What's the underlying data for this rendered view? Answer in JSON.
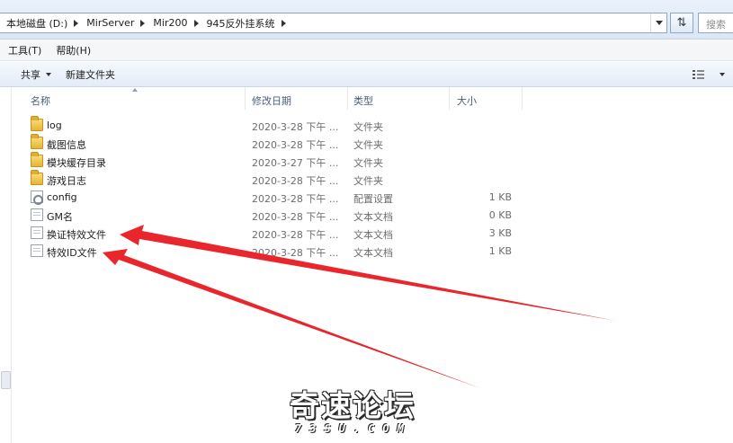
{
  "address_bar": {
    "crumbs": [
      "本地磁盘 (D:)",
      "MirServer",
      "Mir200",
      "945反外挂系统"
    ],
    "search_placeholder": "搜索"
  },
  "menu": {
    "items": [
      "工具(T)",
      "帮助(H)"
    ]
  },
  "toolbar": {
    "share_label": "共享",
    "new_folder_label": "新建文件夹"
  },
  "columns": {
    "name": "名称",
    "date": "修改日期",
    "type": "类型",
    "size": "大小"
  },
  "files": [
    {
      "name": "log",
      "date": "2020-3-28 下午 ...",
      "type": "文件夹",
      "size": "",
      "icon": "folder-icon"
    },
    {
      "name": "截图信息",
      "date": "2020-3-28 下午 ...",
      "type": "文件夹",
      "size": "",
      "icon": "folder-icon"
    },
    {
      "name": "模块缓存目录",
      "date": "2020-3-27 下午 ...",
      "type": "文件夹",
      "size": "",
      "icon": "folder-icon"
    },
    {
      "name": "游戏日志",
      "date": "2020-3-28 下午 ...",
      "type": "文件夹",
      "size": "",
      "icon": "folder-icon"
    },
    {
      "name": "config",
      "date": "2020-3-28 下午 ...",
      "type": "配置设置",
      "size": "1 KB",
      "icon": "settings-file-icon"
    },
    {
      "name": "GM名",
      "date": "2020-3-28 下午 ...",
      "type": "文本文档",
      "size": "0 KB",
      "icon": "text-file-icon"
    },
    {
      "name": "换证特效文件",
      "date": "2020-3-28 下午 ...",
      "type": "文本文档",
      "size": "3 KB",
      "icon": "text-file-icon"
    },
    {
      "name": "特效ID文件",
      "date": "2020-3-28 下午 ...",
      "type": "文本文档",
      "size": "1 KB",
      "icon": "text-file-icon"
    }
  ],
  "annotation_color": "#e8262b",
  "watermark": {
    "title": "奇速论坛",
    "subtitle": "73SU.COM"
  }
}
